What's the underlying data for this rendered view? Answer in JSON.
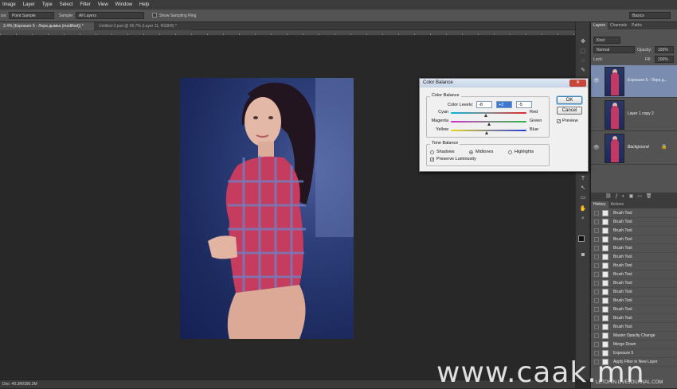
{
  "menu": [
    "Image",
    "Layer",
    "Type",
    "Select",
    "Filter",
    "View",
    "Window",
    "Help"
  ],
  "options": {
    "size_label": "ize:",
    "sample_size": "Point Sample",
    "sample_label": "Sample:",
    "sample_value": "All Layers",
    "show_ring": "Show Sampling Ring",
    "workspace": "Basics"
  },
  "tabs": {
    "active": "2,4% (Exposure 5 - Лера дымка (modified)) *",
    "second": "Untitled-2.psd @ 66.7% (Layer 11, RGB/8) *"
  },
  "status": "Doc: 40.3M/396.3M",
  "panels": {
    "layers_tabs": [
      "Layers",
      "Channels",
      "Paths"
    ],
    "kind": "Kind",
    "blend_mode": "Normal",
    "opacity_label": "Opacity:",
    "opacity_value": "100%",
    "lock_label": "Lock:",
    "fill_label": "Fill:",
    "fill_value": "100%",
    "layers": [
      {
        "name": "Exposure 5 - Лера д..."
      },
      {
        "name": "Layer 1 copy 2"
      },
      {
        "name": "Background"
      }
    ],
    "history_tabs": [
      "History",
      "Actions"
    ],
    "history": [
      "Brush Tool",
      "Brush Tool",
      "Brush Tool",
      "Brush Tool",
      "Brush Tool",
      "Brush Tool",
      "Brush Tool",
      "Brush Tool",
      "Brush Tool",
      "Brush Tool",
      "Brush Tool",
      "Brush Tool",
      "Brush Tool",
      "Brush Tool",
      "Master Opacity Change",
      "Merge Down",
      "Exposure 5",
      "Apply Filter in New Layer"
    ]
  },
  "dialog": {
    "title": "Color Balance",
    "close": "✕",
    "color_balance_group": "Color Balance",
    "color_levels_label": "Color Levels:",
    "levels": [
      "-8",
      "+2",
      "-5"
    ],
    "sliders": [
      {
        "left": "Cyan",
        "right": "Red",
        "value": -8,
        "color_left": "#00b4d8",
        "color_right": "#e0262b"
      },
      {
        "left": "Magenta",
        "right": "Green",
        "value": 2,
        "color_left": "#d22bd0",
        "color_right": "#2db84a"
      },
      {
        "left": "Yellow",
        "right": "Blue",
        "value": -5,
        "color_left": "#e8d81c",
        "color_right": "#2a3fd6"
      }
    ],
    "tone_group": "Tone Balance",
    "tones": [
      "Shadows",
      "Midtones",
      "Highlights"
    ],
    "selected_tone": "Midtones",
    "preserve_label": "Preserve Luminosity",
    "preserve_checked": true,
    "ok": "OK",
    "cancel": "Cancel",
    "preview_label": "Preview",
    "preview_checked": true
  },
  "watermark": {
    "main": "www.caak.mn",
    "sub": "LETOHIN.LIVEJOURNAL.COM"
  }
}
